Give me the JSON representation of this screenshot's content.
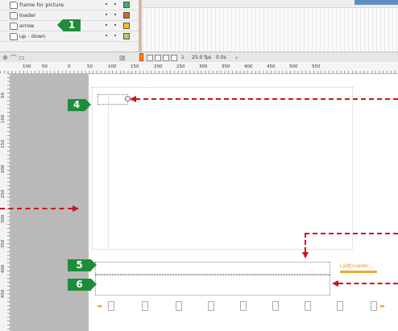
{
  "timeline": {
    "layers": [
      {
        "name": "frame for picture",
        "swatch": "#3cb371"
      },
      {
        "name": "loader",
        "swatch": "#d2691e"
      },
      {
        "name": "arrow",
        "swatch": "#f0c419"
      },
      {
        "name": "up - down",
        "swatch": "#aad36a"
      }
    ],
    "status": {
      "frame": "1",
      "fps": "25.0 fps",
      "time": "0.0s"
    }
  },
  "ruler": {
    "h_labels": [
      "100",
      "50",
      "0",
      "50",
      "100",
      "150",
      "200",
      "250",
      "300",
      "350",
      "400",
      "450",
      "500",
      "550"
    ],
    "v_labels": [
      "50",
      "100",
      "150",
      "200",
      "250",
      "300",
      "350",
      "400",
      "450"
    ]
  },
  "stage": {
    "loader_text": "Lädt/Loader..."
  },
  "callouts": {
    "c1": "1",
    "c4": "4",
    "c5": "5",
    "c6": "6"
  },
  "colors": {
    "callout": "#1f8c3b",
    "arrow": "#d01020",
    "accent": "#f0a830"
  }
}
